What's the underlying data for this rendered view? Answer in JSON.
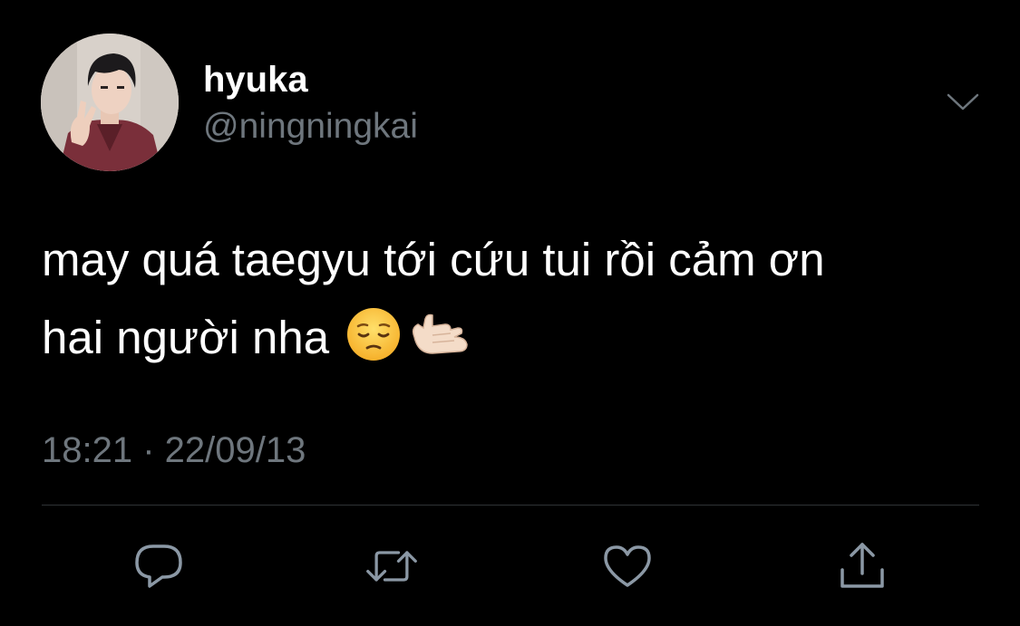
{
  "user": {
    "display_name": "hyuka",
    "handle": "@ningningkai",
    "avatar_icon": "profile-photo"
  },
  "tweet": {
    "text_line1": "may quá taegyu tới cứu tui rồi cảm ơn",
    "text_line2": "hai người nha",
    "emojis": [
      "pensive-face-emoji",
      "call-me-hand-emoji"
    ],
    "timestamp": "18:21 · 22/09/13"
  },
  "actions": {
    "reply_icon": "reply-icon",
    "retweet_icon": "retweet-icon",
    "like_icon": "heart-icon",
    "share_icon": "share-icon",
    "more_icon": "chevron-down-icon"
  },
  "colors": {
    "background": "#000000",
    "primary_text": "#ffffff",
    "secondary_text": "#6e767d",
    "divider": "#2f3336",
    "icon": "#8b98a5"
  }
}
